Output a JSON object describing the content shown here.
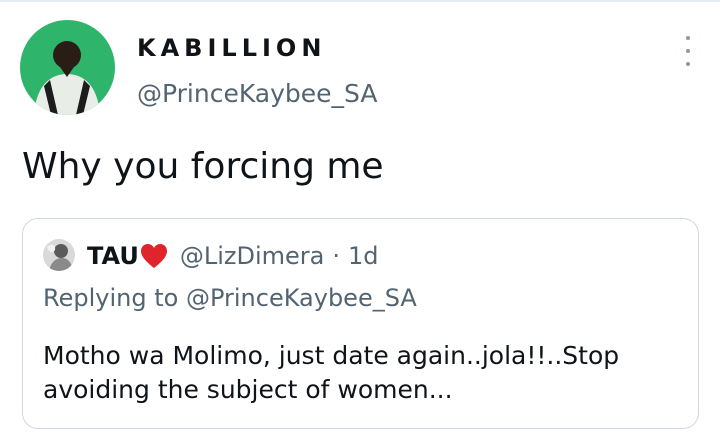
{
  "author": {
    "display_name": "KABILLION",
    "handle": "@PrinceKaybee_SA"
  },
  "tweet": {
    "text": "Why you forcing me"
  },
  "quoted_tweet": {
    "display_name": "TAU",
    "name_emoji": "heart-icon",
    "handle": "@LizDimera",
    "separator": "·",
    "time": "1d",
    "replying_to_label": "Replying to",
    "replying_to_handle": "@PrinceKaybee_SA",
    "text": "Motho wa Molimo, just date again..jola!!..Stop avoiding the subject of women..."
  },
  "icons": {
    "more": "more-vertical-icon"
  },
  "colors": {
    "text_primary": "#0f1419",
    "text_secondary": "#536471",
    "border": "#cfd9de",
    "heart": "#e0242c",
    "avatar_bg": "#2fb56b"
  }
}
